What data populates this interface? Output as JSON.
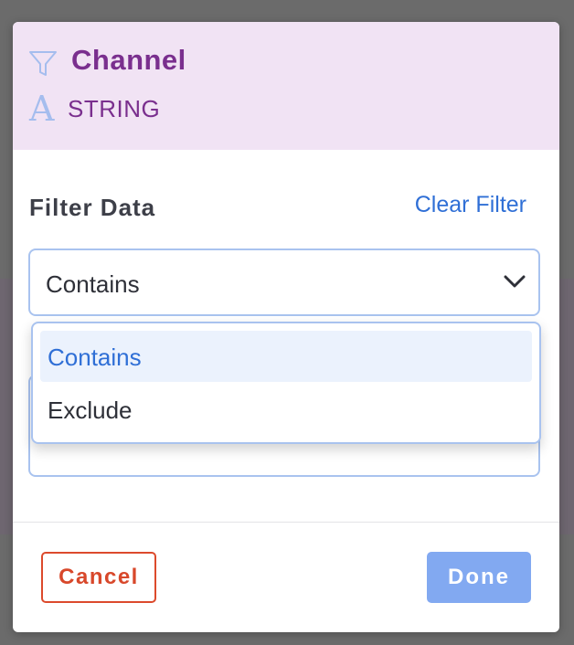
{
  "header": {
    "title": "Channel",
    "type_icon_glyph": "A",
    "type_label": "STRING",
    "filter_icon": "filter-funnel-icon",
    "background_color": "#f1e3f4",
    "title_color": "#7a2f8e"
  },
  "filter": {
    "section_label": "Filter Data",
    "clear_label": "Clear Filter",
    "mode_select": {
      "value": "Contains",
      "options": [
        {
          "label": "Contains",
          "selected": true
        },
        {
          "label": "Exclude",
          "selected": false
        }
      ],
      "open": true
    },
    "value_input": {
      "value": ""
    }
  },
  "footer": {
    "cancel_label": "Cancel",
    "done_label": "Done",
    "cancel_color": "#d8482b",
    "done_color": "#82a9f1"
  }
}
